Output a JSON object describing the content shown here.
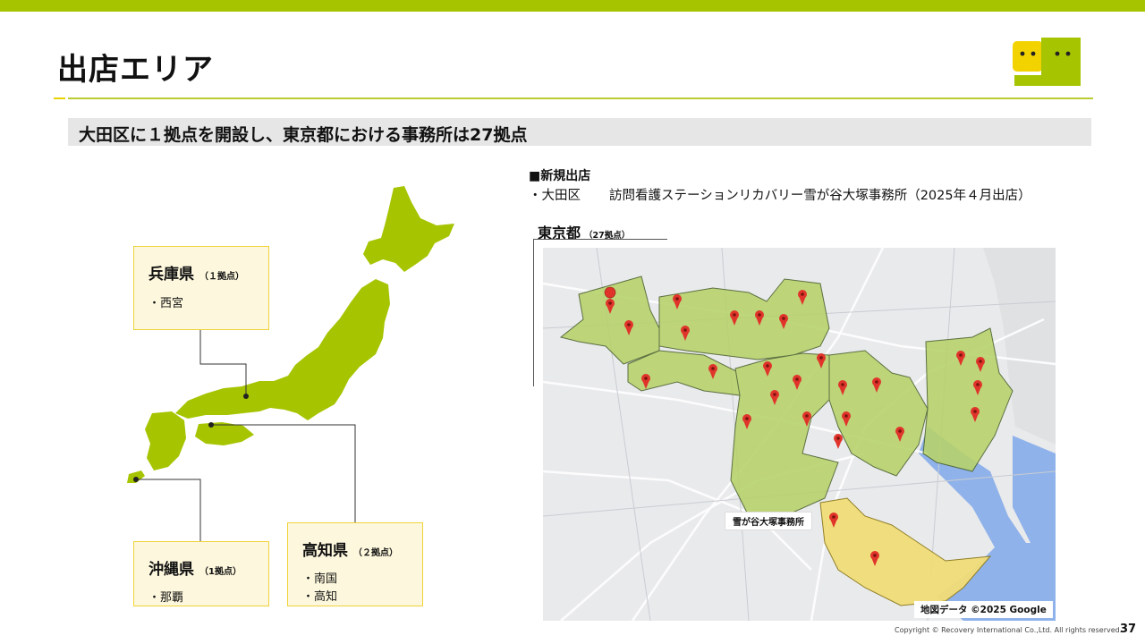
{
  "page": {
    "title": "出店エリア",
    "subheading": "大田区に１拠点を開設し、東京都における事務所は27拠点",
    "page_number": "37",
    "copyright": "Copyright © Recovery International Co.,Ltd. All rights reserved."
  },
  "prefectures": [
    {
      "name": "兵庫県",
      "count": "（１拠点）",
      "items": [
        "・西宮"
      ]
    },
    {
      "name": "沖縄県",
      "count": "（1拠点）",
      "items": [
        "・那覇"
      ]
    },
    {
      "name": "高知県",
      "count": "（２拠点）",
      "items": [
        "・南国",
        "・高知"
      ]
    }
  ],
  "new_store": {
    "heading": "■新規出店",
    "ward": "・大田区",
    "detail": "訪問看護ステーションリカバリー雪が谷大塚事務所（2025年４月出店）"
  },
  "tokyo": {
    "label": "東京都",
    "count": "（27拠点）",
    "office_label": "雪が谷大塚事務所",
    "map_credit": "地図データ ©2025 Google"
  },
  "colors": {
    "brand_green": "#a6c400",
    "brand_yellow": "#f2d300",
    "map_area": "#b7d26a",
    "new_area": "#f1dd78",
    "pin": "#e0342b"
  }
}
